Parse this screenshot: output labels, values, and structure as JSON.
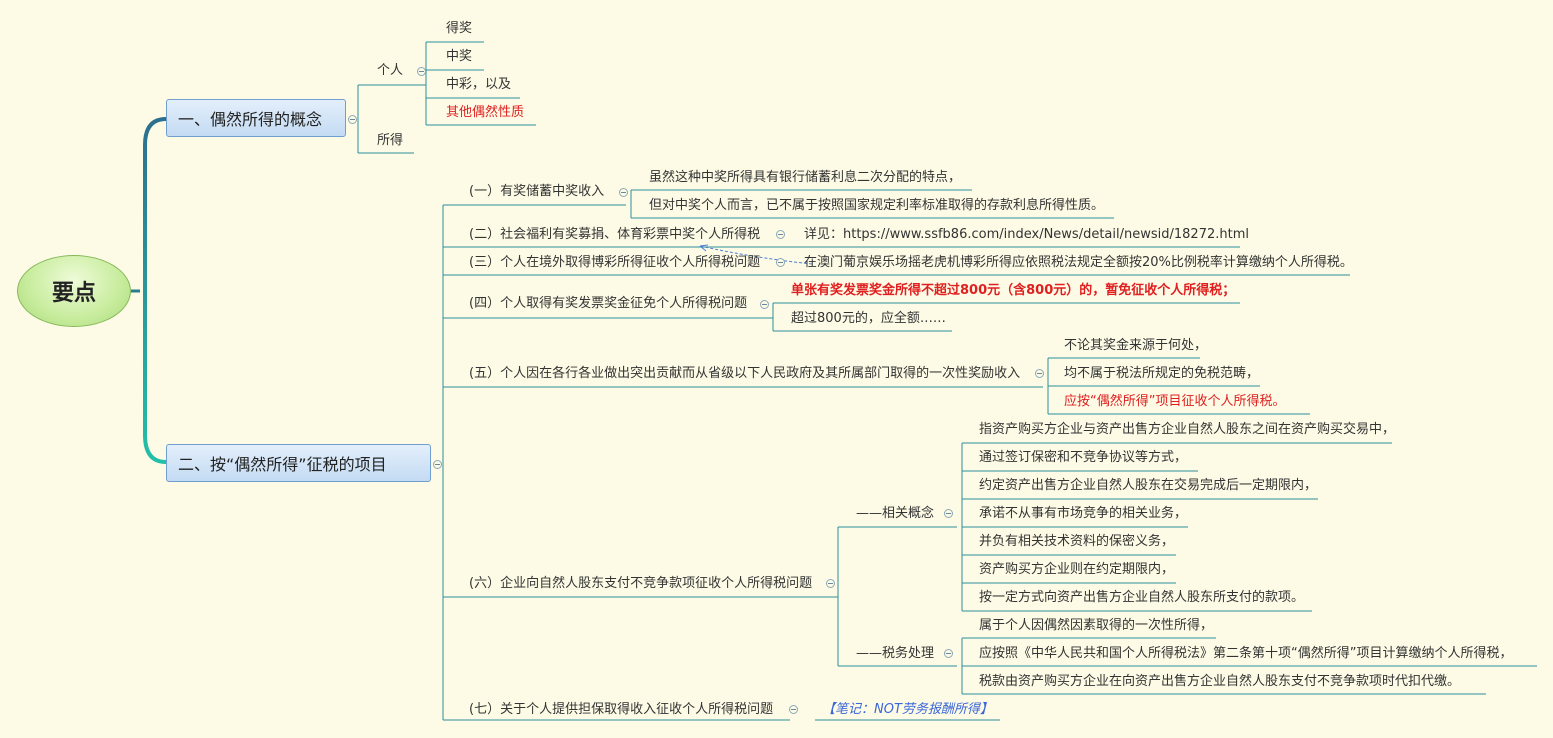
{
  "root": {
    "label": "要点"
  },
  "b1": {
    "label": "一、偶然所得的概念",
    "geren": "个人",
    "items": [
      "得奖",
      "中奖",
      "中彩，以及",
      "其他偶然性质"
    ],
    "suode": "所得"
  },
  "b2": {
    "label": "二、按“偶然所得”征税的项目",
    "s1": {
      "label": "(一）有奖储蓄中奖收入",
      "details": [
        "虽然这种中奖所得具有银行储蓄利息二次分配的特点，",
        "但对中奖个人而言，已不属于按照国家规定利率标准取得的存款利息所得性质。"
      ]
    },
    "s2": {
      "label": "(二）社会福利有奖募捐、体育彩票中奖个人所得税",
      "detail": "详见：https://www.ssfb86.com/index/News/detail/newsid/18272.html"
    },
    "s3": {
      "label": "(三）个人在境外取得博彩所得征收个人所得税问题",
      "detail": "在澳门葡京娱乐场摇老虎机博彩所得应依照税法规定全额按20%比例税率计算缴纳个人所得税。"
    },
    "s4": {
      "label": "(四）个人取得有奖发票奖金征免个人所得税问题",
      "details": [
        "单张有奖发票奖金所得不超过800元（含800元）的，暂免征收个人所得税；",
        "超过800元的，应全额……"
      ]
    },
    "s5": {
      "label": "(五）个人因在各行各业做出突出贡献而从省级以下人民政府及其所属部门取得的一次性奖励收入",
      "details": [
        "不论其奖金来源于何处，",
        "均不属于税法所规定的免税范畴，",
        "应按“偶然所得”项目征收个人所得税。"
      ]
    },
    "s6": {
      "label": "(六）企业向自然人股东支付不竞争款项征收个人所得税问题",
      "concept": {
        "label": "——相关概念",
        "items": [
          "指资产购买方企业与资产出售方企业自然人股东之间在资产购买交易中，",
          "通过签订保密和不竞争协议等方式，",
          "约定资产出售方企业自然人股东在交易完成后一定期限内，",
          "承诺不从事有市场竞争的相关业务，",
          "并负有相关技术资料的保密义务，",
          "资产购买方企业则在约定期限内，",
          "按一定方式向资产出售方企业自然人股东所支付的款项。"
        ]
      },
      "tax": {
        "label": "——税务处理",
        "items": [
          "属于个人因偶然因素取得的一次性所得，",
          "应按照《中华人民共和国个人所得税法》第二条第十项“偶然所得”项目计算缴纳个人所得税，",
          "税款由资产购买方企业在向资产出售方企业自然人股东支付不竞争款项时代扣代缴。"
        ]
      }
    },
    "s7": {
      "label": "(七）关于个人提供担保取得收入征收个人所得税问题",
      "note": "【笔记：NOT劳务报酬所得】"
    }
  },
  "colors": {
    "background": "#fdfbe6",
    "line": "#2a8f9a",
    "red": "#e02020",
    "note": "#3a66d9"
  }
}
